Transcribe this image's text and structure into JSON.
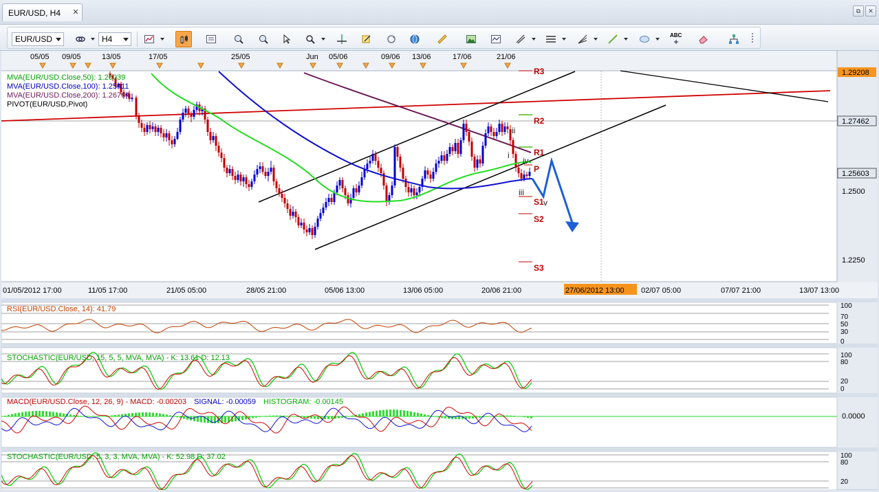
{
  "window": {
    "tab_title": "EUR/USD, H4",
    "tab_close": "✕",
    "restore": "⧉",
    "close": "✕"
  },
  "toolbar": {
    "symbol": "EUR/USD",
    "timeframe": "H4",
    "text_tool": "ABC"
  },
  "chart": {
    "top_dates": [
      "05/05",
      "09/05",
      "13/05",
      "17/05",
      "25/05",
      "Jun",
      "05/06",
      "09/06",
      "13/06",
      "17/06",
      "21/06"
    ],
    "legend": [
      {
        "text": "MVA(EUR/USD.Close,50): 1.26039",
        "color": "#00a000"
      },
      {
        "text": "MVA(EUR/USD.Close,100): 1.25411",
        "color": "#0000c0"
      },
      {
        "text": "MVA(EUR/USD.Close,200): 1.26764",
        "color": "#6b1a55"
      },
      {
        "text": "PIVOT(EUR/USD,Pivot)",
        "color": "#000000"
      }
    ],
    "pivot_labels": [
      "R3",
      "R2",
      "R1",
      "P",
      "S1",
      "S2",
      "S3"
    ],
    "wave_labels": [
      "ii",
      "i",
      "iv",
      "iii",
      "v"
    ],
    "price_axis": {
      "ticks": [
        "1.2500",
        "1.2250"
      ],
      "badges": [
        {
          "text": "1.29208",
          "color": "#f7941d"
        },
        {
          "text": "1.27462",
          "color": "#dfe6ef"
        },
        {
          "text": "1.25603",
          "color": "#dfe6ef"
        }
      ]
    },
    "time_axis": [
      "01/05/2012 17:00",
      "11/05 17:00",
      "21/05 05:00",
      "28/05 21:00",
      "05/06 13:00",
      "13/06 05:00",
      "20/06 21:00",
      "27/06/2012 13:00",
      "02/07 05:00",
      "07/07 21:00",
      "13/07 13:00"
    ]
  },
  "panels": {
    "rsi": {
      "label": "RSI(EUR/USD.Close, 14): 41.79",
      "color": "#c04000",
      "ticks": [
        "100",
        "70",
        "50",
        "30",
        "0"
      ]
    },
    "stoch1": {
      "label": "STOCHASTIC(EUR/USD, 15, 5, 5, MVA, MVA) -  K: 13.61   D: 12.13",
      "color": "#00a000",
      "ticks": [
        "100",
        "80",
        "20",
        "0"
      ]
    },
    "macd": {
      "label_parts": [
        "MACD(EUR/USD.Close, 12, 26, 9) -  MACD: -0.00203",
        "SIGNAL: -0.00059",
        "HISTOGRAM: -0.00145"
      ],
      "colors": [
        "#c00000",
        "#0000c0",
        "#00b000"
      ],
      "tick": "0.0000"
    },
    "stoch2": {
      "label": "STOCHASTIC(EUR/USD, 5, 3, 3, MVA, MVA) -  K: 52.98   D: 37.02",
      "color": "#00a000",
      "ticks": [
        "100",
        "80",
        "20"
      ]
    }
  }
}
